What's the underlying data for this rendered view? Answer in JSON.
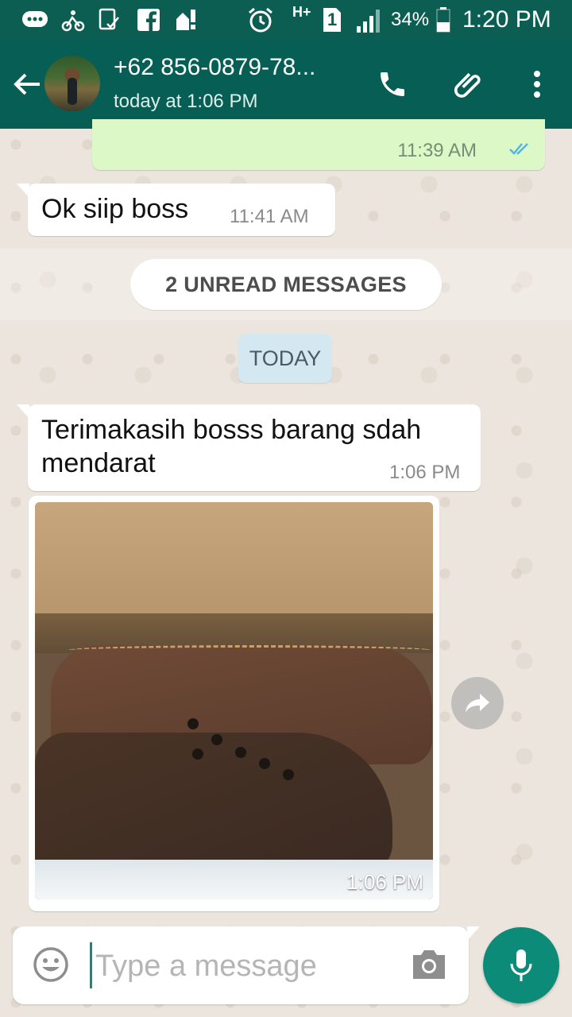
{
  "status_bar": {
    "battery": "34%",
    "time": "1:20 PM",
    "network": "H+",
    "sim": "1"
  },
  "header": {
    "contact_name": "+62 856-0879-78...",
    "last_seen": "today at 1:06 PM"
  },
  "messages": [
    {
      "type": "outgoing",
      "time": "11:39 AM",
      "status": "read"
    },
    {
      "type": "incoming",
      "text": "Ok siip boss",
      "time": "11:41 AM"
    },
    {
      "type": "incoming",
      "text_line1": "Terimakasih bosss barang sdah",
      "text_line2": "mendarat",
      "time": "1:06 PM"
    },
    {
      "type": "incoming-image",
      "time": "1:06 PM"
    }
  ],
  "unread_label": "2 UNREAD MESSAGES",
  "date_label": "TODAY",
  "composer": {
    "placeholder": "Type a message"
  },
  "colors": {
    "header": "#075e54",
    "status_bar": "#0c5e52",
    "outgoing_bubble": "#dcf8c6",
    "mic_button": "#0c8c78",
    "read_ticks": "#4fb6ec"
  }
}
